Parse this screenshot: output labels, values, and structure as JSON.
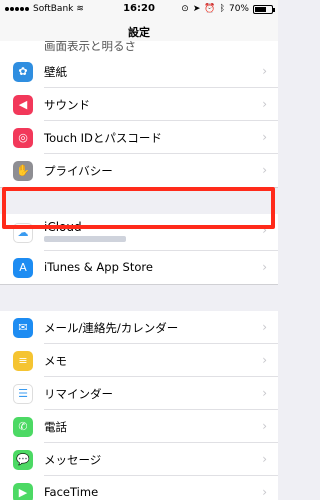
{
  "status_bar": {
    "carrier": "SoftBank",
    "time": "16:20",
    "battery_text": "70%",
    "battery_level": 0.7
  },
  "nav": {
    "title": "設定"
  },
  "partial_top_label": "画面表示と明るさ",
  "groups": [
    [
      {
        "name": "wallpaper",
        "label": "壁紙",
        "icon": "flower-icon",
        "color": "#2f8ee0",
        "glyph": "✿"
      },
      {
        "name": "sounds",
        "label": "サウンド",
        "icon": "speaker-icon",
        "color": "#f2385a",
        "glyph": "◀"
      },
      {
        "name": "touchid",
        "label": "Touch IDとパスコード",
        "icon": "fingerprint-icon",
        "color": "#f2385a",
        "glyph": "◎"
      },
      {
        "name": "privacy",
        "label": "プライバシー",
        "icon": "hand-icon",
        "color": "#8e8e93",
        "glyph": "✋"
      }
    ],
    [
      {
        "name": "icloud",
        "label": "iCloud",
        "icon": "cloud-icon",
        "color": "#ffffff",
        "glyph": "☁"
      },
      {
        "name": "itunes",
        "label": "iTunes & App Store",
        "icon": "appstore-icon",
        "color": "#1d8cf2",
        "glyph": "A"
      }
    ],
    [
      {
        "name": "mail",
        "label": "メール/連絡先/カレンダー",
        "icon": "mail-icon",
        "color": "#1d8cf2",
        "glyph": "✉"
      },
      {
        "name": "notes",
        "label": "メモ",
        "icon": "notes-icon",
        "color": "#f5c431",
        "glyph": "≡"
      },
      {
        "name": "reminders",
        "label": "リマインダー",
        "icon": "reminders-icon",
        "color": "#ffffff",
        "glyph": "☰"
      },
      {
        "name": "phone",
        "label": "電話",
        "icon": "phone-icon",
        "color": "#4cd964",
        "glyph": "✆"
      },
      {
        "name": "messages",
        "label": "メッセージ",
        "icon": "message-icon",
        "color": "#4cd964",
        "glyph": "💬"
      },
      {
        "name": "facetime",
        "label": "FaceTime",
        "icon": "video-icon",
        "color": "#4cd964",
        "glyph": "▶"
      }
    ]
  ]
}
